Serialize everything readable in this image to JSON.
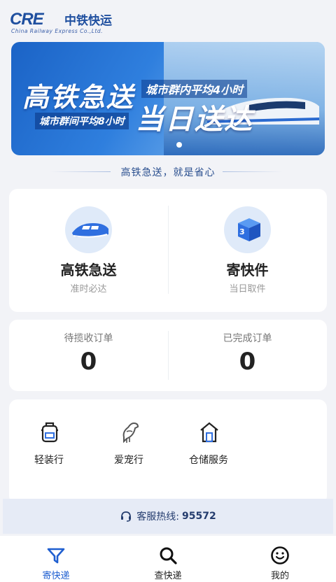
{
  "brand": {
    "logo_mark": "CRE",
    "name_cn": "中铁快运",
    "name_en": "China Railway Express Co.,Ltd."
  },
  "banner": {
    "title": "高铁急送",
    "tag_inner": "城市群内平均4小时",
    "tag_between": "城市群间平均8小时",
    "headline": "当日送达",
    "page_indicator_active": 1
  },
  "slogan": "高铁急送，就是省心",
  "services": [
    {
      "name": "高铁急送",
      "desc": "准时必达",
      "icon": "high-speed-train-icon"
    },
    {
      "name": "寄快件",
      "desc": "当日取件",
      "icon": "parcel-box-icon"
    }
  ],
  "orders": [
    {
      "label": "待揽收订单",
      "count": "0"
    },
    {
      "label": "已完成订单",
      "count": "0"
    }
  ],
  "tools": [
    {
      "label": "轻装行",
      "icon": "backpack-icon"
    },
    {
      "label": "爱宠行",
      "icon": "bird-icon"
    },
    {
      "label": "仓储服务",
      "icon": "warehouse-icon"
    }
  ],
  "hotline": {
    "label": "客服热线:",
    "number": "95572"
  },
  "tabbar": [
    {
      "label": "寄快递",
      "icon": "send-icon",
      "active": true
    },
    {
      "label": "查快递",
      "icon": "search-icon",
      "active": false
    },
    {
      "label": "我的",
      "icon": "smiley-icon",
      "active": false
    }
  ],
  "colors": {
    "accent": "#1f5fd0",
    "brand_blue": "#1f4f9f",
    "background": "#f2f3f7"
  }
}
